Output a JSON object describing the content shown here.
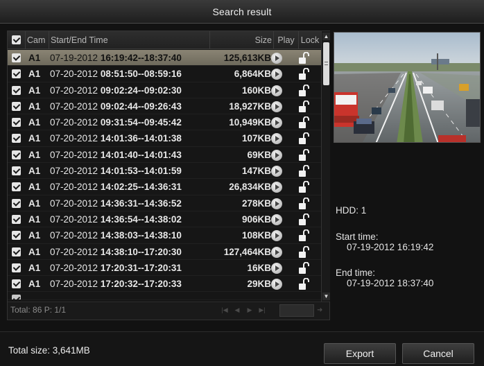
{
  "window": {
    "title": "Search result"
  },
  "list": {
    "headers": {
      "cam": "Cam",
      "time": "Start/End Time",
      "size": "Size",
      "play": "Play",
      "lock": "Lock"
    },
    "rows": [
      {
        "cam": "A1",
        "date": "07-19-2012",
        "time": "16:19:42--18:37:40",
        "size": "125,613KB",
        "selected": true
      },
      {
        "cam": "A1",
        "date": "07-20-2012",
        "time": "08:51:50--08:59:16",
        "size": "6,864KB"
      },
      {
        "cam": "A1",
        "date": "07-20-2012",
        "time": "09:02:24--09:02:30",
        "size": "160KB"
      },
      {
        "cam": "A1",
        "date": "07-20-2012",
        "time": "09:02:44--09:26:43",
        "size": "18,927KB"
      },
      {
        "cam": "A1",
        "date": "07-20-2012",
        "time": "09:31:54--09:45:42",
        "size": "10,949KB"
      },
      {
        "cam": "A1",
        "date": "07-20-2012",
        "time": "14:01:36--14:01:38",
        "size": "107KB"
      },
      {
        "cam": "A1",
        "date": "07-20-2012",
        "time": "14:01:40--14:01:43",
        "size": "69KB"
      },
      {
        "cam": "A1",
        "date": "07-20-2012",
        "time": "14:01:53--14:01:59",
        "size": "147KB"
      },
      {
        "cam": "A1",
        "date": "07-20-2012",
        "time": "14:02:25--14:36:31",
        "size": "26,834KB"
      },
      {
        "cam": "A1",
        "date": "07-20-2012",
        "time": "14:36:31--14:36:52",
        "size": "278KB"
      },
      {
        "cam": "A1",
        "date": "07-20-2012",
        "time": "14:36:54--14:38:02",
        "size": "906KB"
      },
      {
        "cam": "A1",
        "date": "07-20-2012",
        "time": "14:38:03--14:38:10",
        "size": "108KB"
      },
      {
        "cam": "A1",
        "date": "07-20-2012",
        "time": "14:38:10--17:20:30",
        "size": "127,464KB"
      },
      {
        "cam": "A1",
        "date": "07-20-2012",
        "time": "17:20:31--17:20:31",
        "size": "16KB"
      },
      {
        "cam": "A1",
        "date": "07-20-2012",
        "time": "17:20:32--17:20:33",
        "size": "29KB"
      }
    ],
    "pager": {
      "total": "Total: 86  P: 1/1"
    }
  },
  "info": {
    "hdd": "HDD: 1",
    "start_label": "Start time:",
    "start_value": "07-19-2012 16:19:42",
    "end_label": "End time:",
    "end_value": "07-19-2012 18:37:40"
  },
  "footer": {
    "total_size": "Total size: 3,641MB",
    "export_label": "Export",
    "cancel_label": "Cancel"
  },
  "icons": {
    "checkbox": "check-icon",
    "play": "play-icon",
    "lock": "unlock-icon"
  }
}
